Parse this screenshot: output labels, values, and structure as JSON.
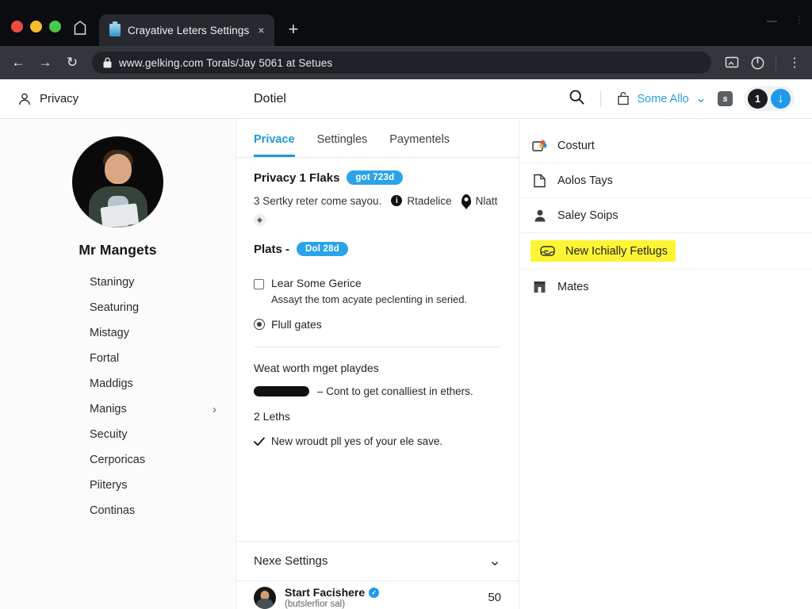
{
  "browser": {
    "tab": {
      "title": "Crayative Leters Settings",
      "close_label": "×"
    },
    "new_tab_label": "+",
    "url": "www.gelking.com  Torals/Jay 5061 at Setues",
    "back_label": "←",
    "forward_label": "→",
    "reload_label": "↻",
    "menu_label": "⋮"
  },
  "app_header": {
    "left_label": "Privacy",
    "title": "Dotiel",
    "account_label": "Some Allo",
    "account_chevron": "⌄",
    "square_icon_letter": "s",
    "badge_count": "1",
    "download_glyph": "↓"
  },
  "sidebar": {
    "profile_name": "Mr Mangets",
    "items": [
      {
        "label": "Staningy",
        "chevron": ""
      },
      {
        "label": "Seaturing",
        "chevron": ""
      },
      {
        "label": "Mistagy",
        "chevron": ""
      },
      {
        "label": "Fortal",
        "chevron": ""
      },
      {
        "label": "Maddigs",
        "chevron": ""
      },
      {
        "label": "Manigs",
        "chevron": "›"
      },
      {
        "label": "Secuity",
        "chevron": ""
      },
      {
        "label": "Cerporicas",
        "chevron": ""
      },
      {
        "label": "Piiterys",
        "chevron": ""
      },
      {
        "label": "Continas",
        "chevron": ""
      }
    ]
  },
  "main": {
    "tabs": [
      {
        "label": "Privace",
        "active": true
      },
      {
        "label": "Settingles",
        "active": false
      },
      {
        "label": "Paymentels",
        "active": false
      }
    ],
    "privacy_heading": "Privacy 1 Flaks",
    "privacy_badge": "got 723d",
    "privacy_subtext": "3 Sertky reter come sayou.",
    "info_label": "Rtadelice",
    "pin_label": "Nlatt",
    "small_circle_glyph": "◆",
    "plats_heading": "Plats -",
    "plats_badge": "Dol 28d",
    "checkbox_label": "Lear Some Gerice",
    "checkbox_desc": "Assayt the tom acyate peclenting in seried.",
    "gates_label": "Flull gates",
    "weat_label": "Weat worth mget playdes",
    "redacted_text": "–  Cont to get conalliest in ethers.",
    "leths_label": "2  Leths",
    "check_text": "New wroudt pll yes of your ele save.",
    "nexe_label": "Nexe Settings",
    "nexe_chevron": "⌄",
    "person_name": "Start Facishere",
    "person_verified": "✓",
    "person_sub": "(butslerfior sal)",
    "person_count": "50"
  },
  "right_panel": {
    "items": [
      {
        "label": "Costurt",
        "icon": "photos-icon",
        "highlighted": false
      },
      {
        "label": "Aolos Tays",
        "icon": "document-icon",
        "highlighted": false
      },
      {
        "label": "Saley Soips",
        "icon": "person-icon",
        "highlighted": false
      },
      {
        "label": "New Ichially Fetlugs",
        "icon": "inbox-icon",
        "highlighted": true
      },
      {
        "label": "Mates",
        "icon": "building-icon",
        "highlighted": false
      }
    ]
  },
  "colors": {
    "accent_blue": "#1f9ad3",
    "badge_blue": "#2aa3e8",
    "highlight_yellow": "#fdf534",
    "chrome_dark": "#33363b"
  }
}
